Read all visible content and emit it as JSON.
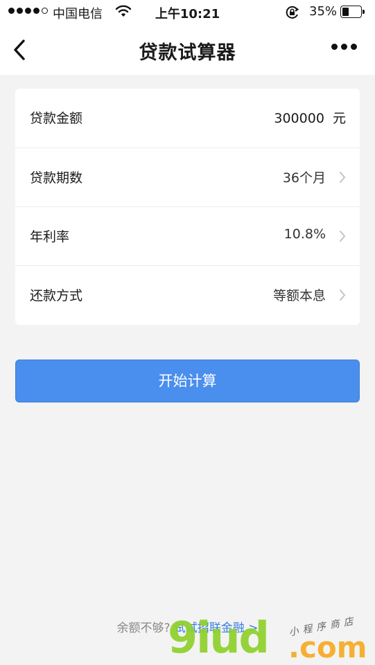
{
  "status_bar": {
    "carrier": "中国电信",
    "time": "上午10:21",
    "battery_pct": "35%",
    "battery_level": 0.35,
    "signal_bars_filled": 4,
    "signal_bars_total": 5
  },
  "nav": {
    "title": "贷款试算器",
    "back_icon": "chevron-left-icon",
    "more_icon": "more-dots-icon"
  },
  "form": {
    "rows": [
      {
        "label": "贷款金额",
        "value": "300000  元",
        "has_arrow": false
      },
      {
        "label": "贷款期数",
        "value": "36个月",
        "has_arrow": true
      },
      {
        "label": "年利率",
        "value": "10.8%",
        "has_arrow": true
      },
      {
        "label": "还款方式",
        "value": "等额本息",
        "has_arrow": true
      }
    ]
  },
  "calculate_button": {
    "label": "开始计算",
    "color": "#4a8eee"
  },
  "footer": {
    "prefix": "余额不够?",
    "link": "试试招联金融 >"
  },
  "watermark": {
    "brand": "9iud",
    "domain": ".com",
    "tagline": "小程序商店"
  }
}
